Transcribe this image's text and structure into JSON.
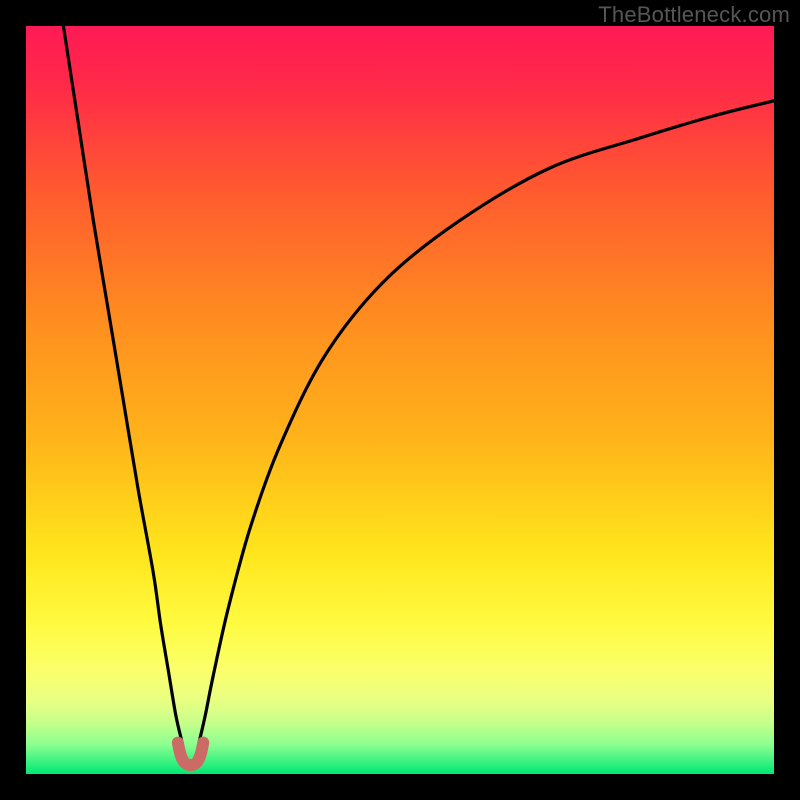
{
  "watermark": "TheBottleneck.com",
  "chart_data": {
    "type": "line",
    "title": "",
    "xlabel": "",
    "ylabel": "",
    "xlim": [
      0,
      100
    ],
    "ylim": [
      0,
      100
    ],
    "gradient_stops": [
      {
        "pct": 0,
        "color": "#ff1a55"
      },
      {
        "pct": 8,
        "color": "#ff2a48"
      },
      {
        "pct": 22,
        "color": "#ff5a2f"
      },
      {
        "pct": 40,
        "color": "#ff8f1f"
      },
      {
        "pct": 55,
        "color": "#ffb31a"
      },
      {
        "pct": 70,
        "color": "#ffe41b"
      },
      {
        "pct": 80,
        "color": "#fffb40"
      },
      {
        "pct": 86,
        "color": "#fbff6a"
      },
      {
        "pct": 90,
        "color": "#eaff82"
      },
      {
        "pct": 93,
        "color": "#c9ff8a"
      },
      {
        "pct": 96,
        "color": "#8dff90"
      },
      {
        "pct": 100,
        "color": "#00e874"
      }
    ],
    "series": [
      {
        "name": "bottleneck-curve-left",
        "x": [
          5,
          7,
          9,
          11,
          13,
          15,
          17,
          18,
          19,
          20,
          20.8
        ],
        "values": [
          100,
          87,
          74,
          62,
          50,
          38,
          27,
          20,
          14,
          8,
          4.5
        ]
      },
      {
        "name": "bottleneck-curve-right",
        "x": [
          23.2,
          24,
          25,
          27,
          30,
          34,
          40,
          48,
          58,
          70,
          82,
          92,
          100
        ],
        "values": [
          4.5,
          8,
          13,
          22,
          33,
          44,
          56,
          66,
          74,
          81,
          85,
          88,
          90
        ]
      },
      {
        "name": "marker-u-shape",
        "x": [
          20.3,
          20.6,
          21.0,
          21.5,
          22.0,
          22.5,
          23.0,
          23.4,
          23.7
        ],
        "values": [
          4.2,
          2.8,
          1.8,
          1.3,
          1.2,
          1.3,
          1.8,
          2.8,
          4.2
        ]
      }
    ],
    "annotations": []
  }
}
